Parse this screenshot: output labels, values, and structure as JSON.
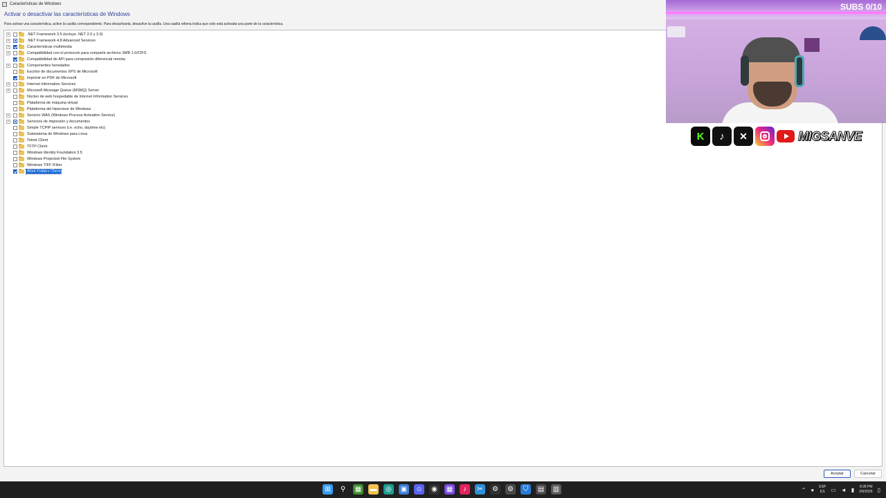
{
  "window": {
    "title": "Características de Windows",
    "heading": "Activar o desactivar las características de Windows",
    "instructions": "Para activar una característica, active la casilla correspondiente. Para desactivarla, desactive la casilla. Una casilla rellena indica que solo está activada una parte de la característica."
  },
  "features": [
    {
      "label": ".NET Framework 3.5 (incluye .NET 2.0 y 3.0)",
      "expandable": true,
      "state": "unchecked",
      "selected": false
    },
    {
      "label": ".NET Framework 4.8 Advanced Services",
      "expandable": true,
      "state": "partial",
      "selected": false
    },
    {
      "label": "Características multimedia",
      "expandable": true,
      "state": "checked",
      "selected": false
    },
    {
      "label": "Compatibilidad con el protocolo para compartir archivos SMB 1.0/CIFS",
      "expandable": true,
      "state": "unchecked",
      "selected": false
    },
    {
      "label": "Compatibilidad de API para compresión diferencial remota",
      "expandable": false,
      "state": "checked",
      "selected": false
    },
    {
      "label": "Componentes heredados",
      "expandable": true,
      "state": "unchecked",
      "selected": false
    },
    {
      "label": "Escritor de documentos XPS de Microsoft",
      "expandable": false,
      "state": "unchecked",
      "selected": false
    },
    {
      "label": "Imprimir en PDF de Microsoft",
      "expandable": false,
      "state": "checked",
      "selected": false
    },
    {
      "label": "Internet Information Services",
      "expandable": true,
      "state": "unchecked",
      "selected": false
    },
    {
      "label": "Microsoft Message Queue (MSMQ) Server",
      "expandable": true,
      "state": "unchecked",
      "selected": false
    },
    {
      "label": "Núcleo de web hospedable de Internet Information Services",
      "expandable": false,
      "state": "unchecked",
      "selected": false
    },
    {
      "label": "Plataforma de máquina virtual",
      "expandable": false,
      "state": "unchecked",
      "selected": false
    },
    {
      "label": "Plataforma del hipervisor de Windows",
      "expandable": false,
      "state": "unchecked",
      "selected": false
    },
    {
      "label": "Servicio WAS (Windows Process Activation Service)",
      "expandable": true,
      "state": "unchecked",
      "selected": false
    },
    {
      "label": "Servicios de impresión y documentos",
      "expandable": true,
      "state": "partial",
      "selected": false
    },
    {
      "label": "Simple TCPIP services (i.e. echo, daytime etc)",
      "expandable": false,
      "state": "unchecked",
      "selected": false
    },
    {
      "label": "Subsistema de Windows para Linux",
      "expandable": false,
      "state": "unchecked",
      "selected": false
    },
    {
      "label": "Telnet Client",
      "expandable": false,
      "state": "unchecked",
      "selected": false
    },
    {
      "label": "TFTP Client",
      "expandable": false,
      "state": "unchecked",
      "selected": false
    },
    {
      "label": "Windows Identity Foundation 3.5",
      "expandable": false,
      "state": "unchecked",
      "selected": false
    },
    {
      "label": "Windows Projected File System",
      "expandable": false,
      "state": "unchecked",
      "selected": false
    },
    {
      "label": "Windows TIFF IFilter",
      "expandable": false,
      "state": "unchecked",
      "selected": false
    },
    {
      "label": "Work Folders Client",
      "expandable": false,
      "state": "checked",
      "selected": true
    }
  ],
  "buttons": {
    "ok": "Aceptar",
    "cancel": "Cancelar"
  },
  "overlay": {
    "subs": "SUBS 0/10",
    "handle": "MIGSANVE",
    "social_icons": [
      "kick-icon",
      "tiktok-icon",
      "x-icon",
      "instagram-icon",
      "youtube-icon"
    ]
  },
  "taskbar": {
    "apps": [
      {
        "icon": "windows-start-icon",
        "color": "#3a9bf0"
      },
      {
        "icon": "search-icon",
        "color": "#202020"
      },
      {
        "icon": "minecraft-icon",
        "color": "#3f8f2e"
      },
      {
        "icon": "file-explorer-icon",
        "color": "#f2c14e"
      },
      {
        "icon": "edge-icon",
        "color": "#1f9b8f"
      },
      {
        "icon": "store-icon",
        "color": "#3c7bd6"
      },
      {
        "icon": "discord-icon",
        "color": "#5865f2"
      },
      {
        "icon": "obs-icon",
        "color": "#303030"
      },
      {
        "icon": "grid-app-icon",
        "color": "#7a4ce6"
      },
      {
        "icon": "tiktok-app-icon",
        "color": "#e0245e"
      },
      {
        "icon": "snipping-tool-icon",
        "color": "#2f8fd8"
      },
      {
        "icon": "settings-icon",
        "color": "#303030"
      },
      {
        "icon": "gear-icon",
        "color": "#4a4a4a"
      },
      {
        "icon": "defender-icon",
        "color": "#2a7dd6"
      },
      {
        "icon": "control-panel-icon",
        "color": "#4a4a4a"
      },
      {
        "icon": "features-dialog-icon",
        "color": "#5a5a5a"
      }
    ],
    "lang_top": "ESP",
    "lang_bottom": "ES",
    "time": "8:28 PM",
    "date": "2/9/2026"
  },
  "colors": {
    "accent": "#0a64d8",
    "heading": "#2b3f9b",
    "taskbar": "#202020"
  }
}
